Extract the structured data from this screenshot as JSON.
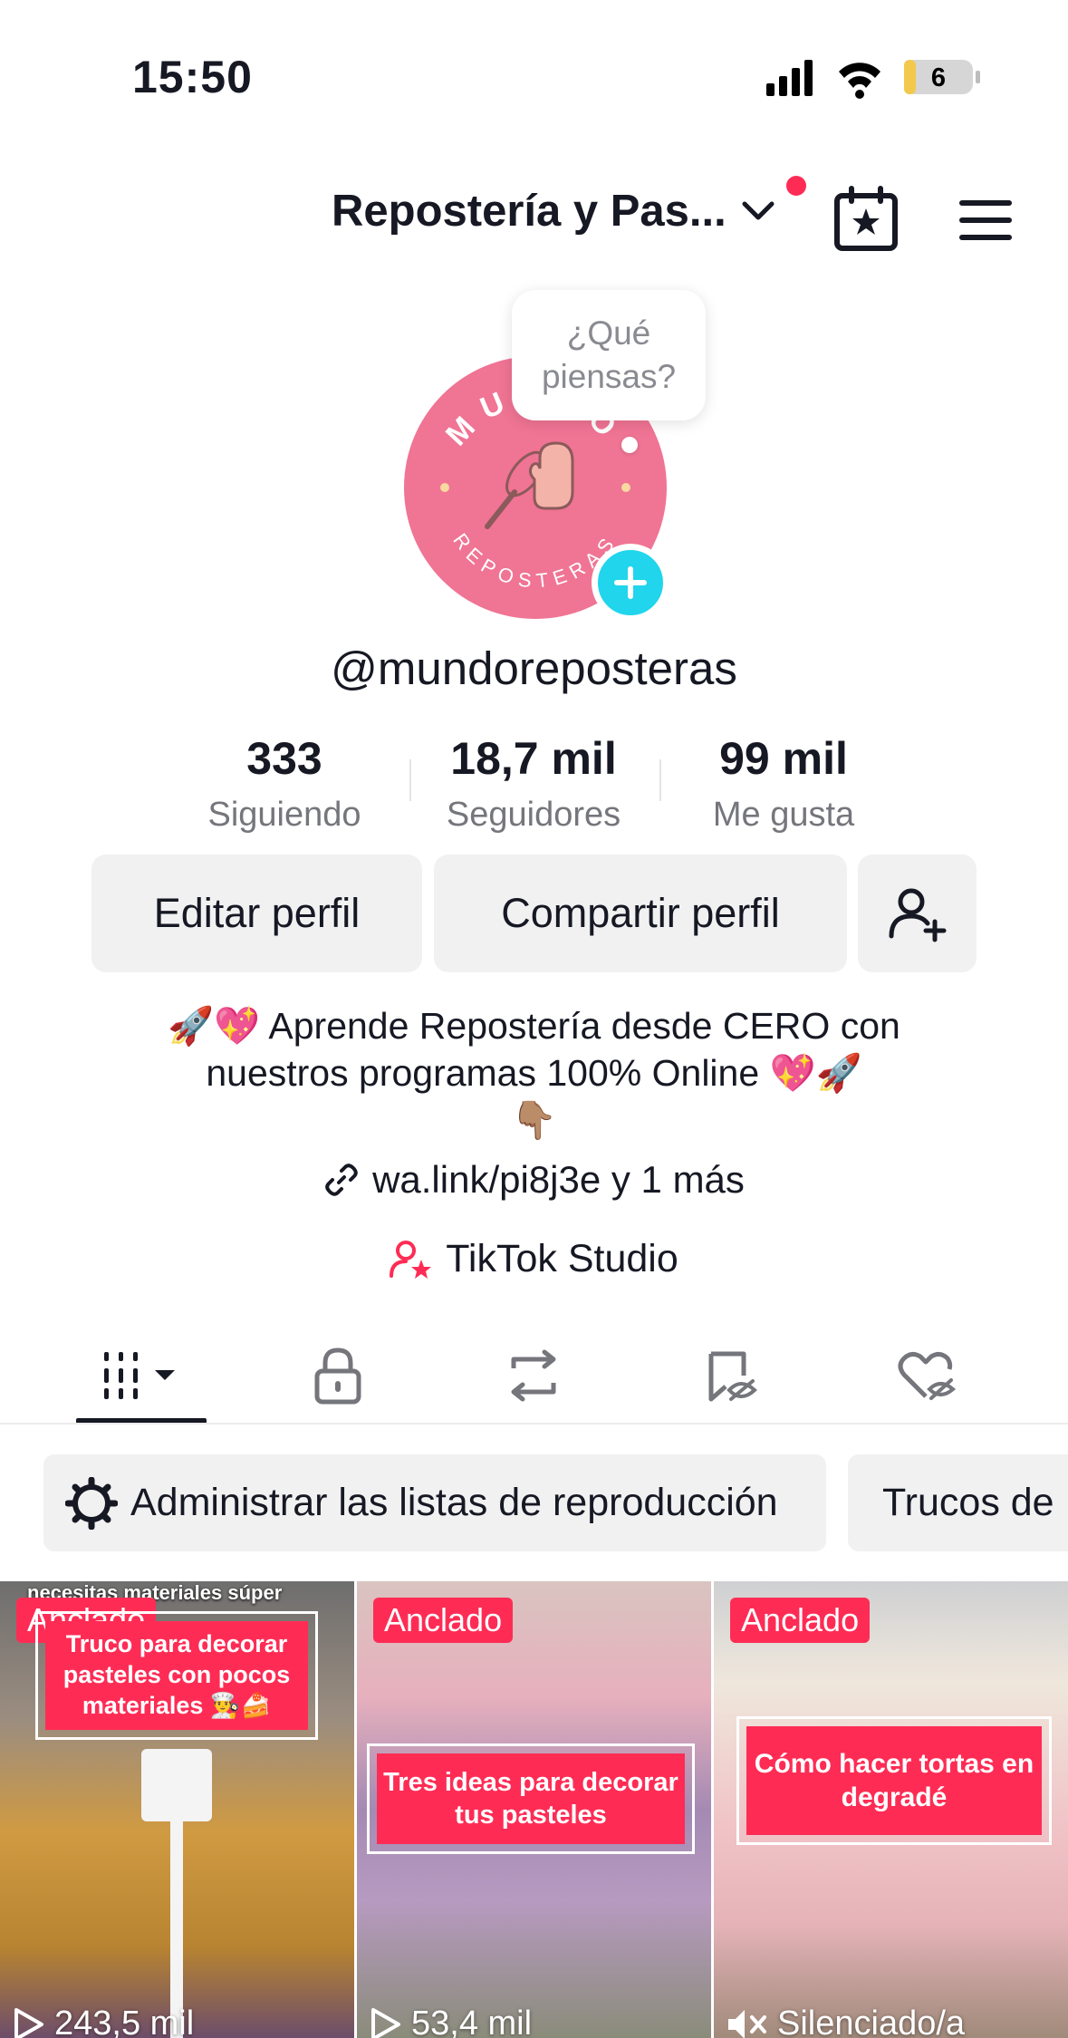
{
  "status_bar": {
    "time": "15:50",
    "battery": "6",
    "icons": [
      "signal-icon",
      "wifi-icon",
      "battery-icon"
    ]
  },
  "header": {
    "account_name": "Repostería y Pas...",
    "icons": [
      "chevron-down-icon",
      "calendar-star-icon",
      "hamburger-menu-icon"
    ]
  },
  "avatar": {
    "logo_top": "MUNDO",
    "logo_bottom": "REPOSTERAS",
    "bubble_text": "¿Qué piensas?"
  },
  "profile": {
    "username": "@mundoreposteras"
  },
  "stats": [
    {
      "value": "333",
      "label": "Siguiendo"
    },
    {
      "value": "18,7 mil",
      "label": "Seguidores"
    },
    {
      "value": "99 mil",
      "label": "Me gusta"
    }
  ],
  "actions": {
    "edit": "Editar perfil",
    "share": "Compartir perfil"
  },
  "bio": {
    "line1": "🚀💖 Aprende Repostería desde CERO con",
    "line2": "nuestros programas 100% Online 💖🚀",
    "line3": "👇🏽",
    "link": "wa.link/pi8j3e y 1 más",
    "studio": "TikTok Studio"
  },
  "playlists": [
    {
      "label": "Administrar las listas de reproducción",
      "icon": "gear-icon"
    },
    {
      "label": "Trucos de",
      "icon": "playlist-icon"
    }
  ],
  "videos": [
    {
      "pinned": "Anclado",
      "top_text": "necesitas materiales súper",
      "caption": "Truco para decorar pasteles con pocos materiales 👨‍🍳🍰",
      "views": "243,5 mil",
      "bg": "#c98a2e"
    },
    {
      "pinned": "Anclado",
      "caption": "Tres ideas para decorar tus pasteles",
      "views": "53,4 mil",
      "bg": "#a88aa8"
    },
    {
      "pinned": "Anclado",
      "caption": "Cómo hacer tortas en degradé",
      "views": "Silenciado/a",
      "bg": "#e6b4b8"
    }
  ],
  "colors": {
    "accent": "#fe2c55",
    "teal": "#20d5ec",
    "avatar_pink": "#f07494",
    "button_bg": "#f1f1f2"
  }
}
